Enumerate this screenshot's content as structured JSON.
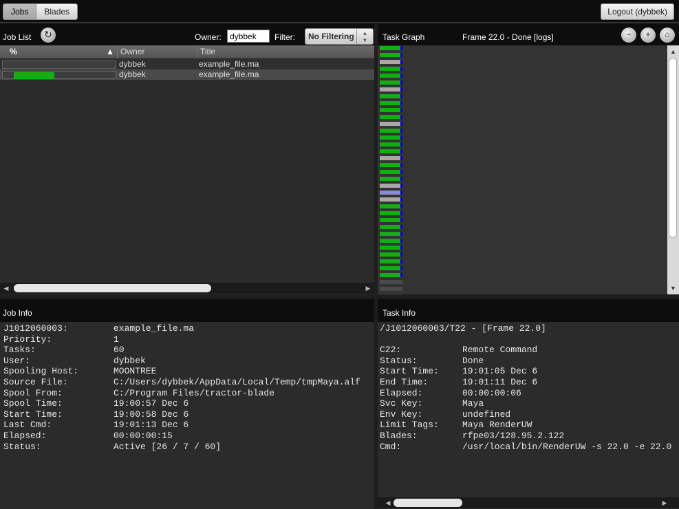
{
  "topbar": {
    "tabs": [
      {
        "label": "Jobs",
        "active": true
      },
      {
        "label": "Blades",
        "active": false
      }
    ],
    "logout_label": "Logout (dybbek)"
  },
  "job_list": {
    "title": "Job List",
    "owner_label": "Owner:",
    "owner_value": "dybbek",
    "filter_label": "Filter:",
    "filter_value": "No Filtering",
    "columns": [
      "%",
      "Owner",
      "Title"
    ],
    "rows": [
      {
        "progress": 0.0,
        "owner": "dybbek",
        "title": "example_file.ma"
      },
      {
        "progress": 0.39,
        "owner": "dybbek",
        "title": "example_file.ma"
      }
    ]
  },
  "task_graph": {
    "title": "Task Graph",
    "frame_status": "Frame 22.0 - Done  [logs]",
    "tasks": [
      "done",
      "done",
      "idle",
      "done",
      "done",
      "done",
      "idle",
      "done",
      "done",
      "done",
      "done",
      "idle",
      "done",
      "done",
      "done",
      "done",
      "idle",
      "done",
      "done",
      "done",
      "idle",
      "active",
      "idle",
      "done",
      "done",
      "done",
      "done",
      "done",
      "done",
      "done",
      "done",
      "done",
      "done",
      "done",
      "blocked",
      "blocked",
      "blocked",
      "blocked"
    ],
    "colors": {
      "done": "#11b011",
      "idle": "#a8a8a8",
      "active": "#8c8cd6",
      "blocked": "#4a4a4a",
      "marker": "#0000d6"
    }
  },
  "job_info": {
    "title": "Job Info",
    "rows": [
      {
        "key": "J1012060003:",
        "value": "example_file.ma"
      },
      {
        "key": "Priority:",
        "value": "1"
      },
      {
        "key": "Tasks:",
        "value": "60"
      },
      {
        "key": "User:",
        "value": "dybbek"
      },
      {
        "key": "Spooling Host:",
        "value": "MOONTREE"
      },
      {
        "key": "Source File:",
        "value": "C:/Users/dybbek/AppData/Local/Temp/tmpMaya.alf"
      },
      {
        "key": "Spool From:",
        "value": "C:/Program Files/tractor-blade"
      },
      {
        "key": "Spool Time:",
        "value": "19:00:57 Dec  6"
      },
      {
        "key": "Start Time:",
        "value": "19:00:58 Dec  6"
      },
      {
        "key": "Last Cmd:",
        "value": "19:01:13 Dec  6"
      },
      {
        "key": "Elapsed:",
        "value": "00:00:00:15"
      },
      {
        "key": "Status:",
        "value": "Active  [26 / 7 / 60]"
      }
    ]
  },
  "task_info": {
    "title": "Task Info",
    "path": "/J1012060003/T22 - [Frame 22.0]",
    "rows": [
      {
        "key": "C22:",
        "value": "Remote Command"
      },
      {
        "key": "Status:",
        "value": "Done"
      },
      {
        "key": "Start Time:",
        "value": "19:01:05 Dec  6"
      },
      {
        "key": "End Time:",
        "value": "19:01:11 Dec  6"
      },
      {
        "key": "Elapsed:",
        "value": "00:00:00:06"
      },
      {
        "key": "Svc Key:",
        "value": "Maya"
      },
      {
        "key": "Env Key:",
        "value": "undefined"
      },
      {
        "key": "Limit Tags:",
        "value": "Maya RenderUW"
      },
      {
        "key": "Blades:",
        "value": "rfpe03/128.95.2.122"
      },
      {
        "key": "Cmd:",
        "value": "/usr/local/bin/RenderUW -s 22.0 -e 22.0"
      }
    ]
  }
}
